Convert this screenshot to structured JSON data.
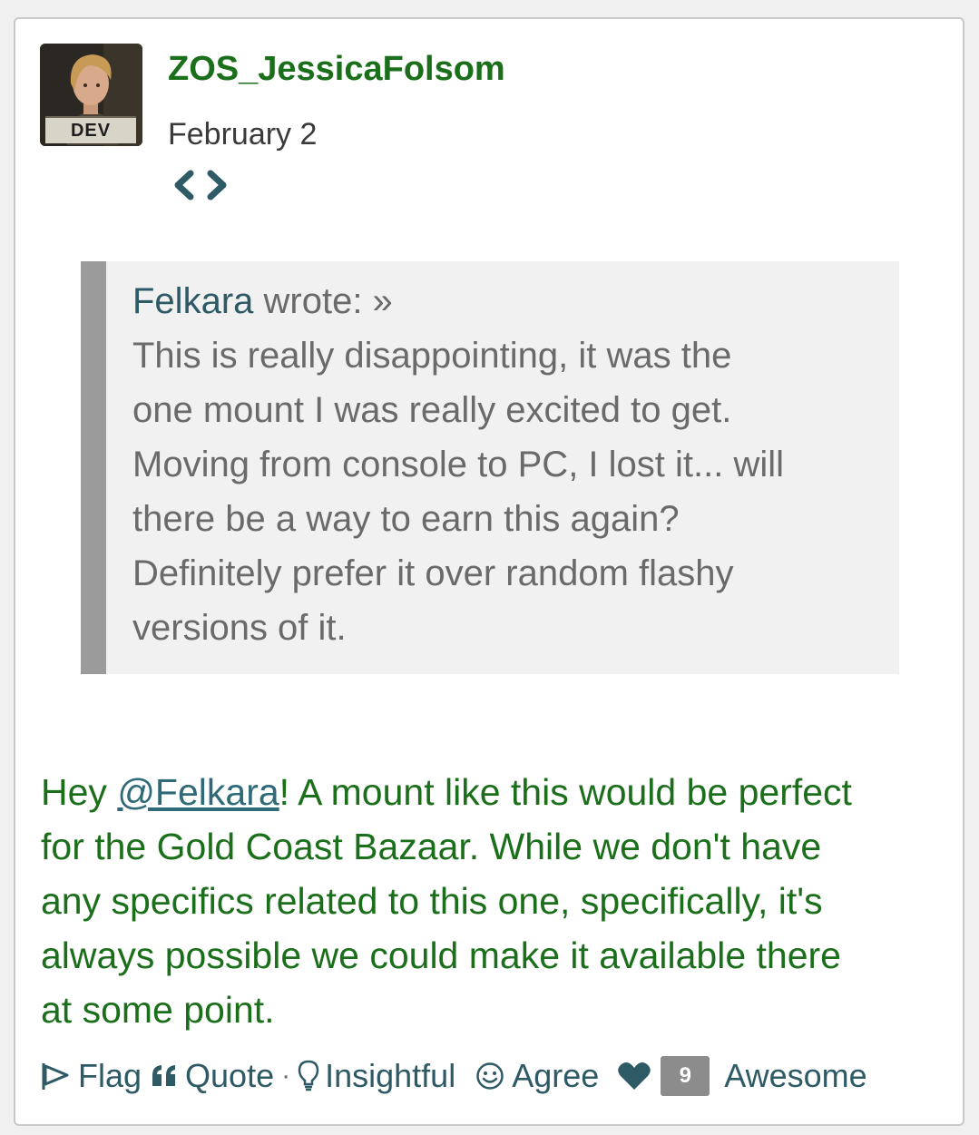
{
  "post": {
    "author": "ZOS_JessicaFolsom",
    "badge": "DEV",
    "date": "February 2",
    "quote": {
      "author": "Felkara",
      "wrote": " wrote: »",
      "lines": [
        "This is really disappointing, it was the",
        "one mount I was really excited to get.",
        "Moving from console to PC, I lost it... will",
        "there be a way to earn this again?",
        "Definitely prefer it over random flashy",
        "versions of it."
      ]
    },
    "reply": {
      "greeting": "Hey ",
      "mention": "@Felkara",
      "line1_rest": "! A mount like this would be perfect",
      "lines": [
        "for the Gold Coast Bazaar. While we don't have",
        "any specifics related to this one, specifically, it's",
        "always possible we could make it available there",
        "at some point."
      ]
    },
    "reactions": {
      "flag": "Flag",
      "quote": "Quote",
      "separator": "·",
      "insightful": "Insightful",
      "agree": "Agree",
      "awesome_count": "9",
      "awesome": "Awesome"
    }
  },
  "colors": {
    "author_green": "#1b6f1b",
    "link_teal": "#2e5a66",
    "quote_bg": "#f1f1f1",
    "quote_bar": "#9b9b9b"
  },
  "icons": [
    "embed-code-icon",
    "flag-icon",
    "quote-icon",
    "lightbulb-icon",
    "smiley-icon",
    "heart-icon"
  ]
}
